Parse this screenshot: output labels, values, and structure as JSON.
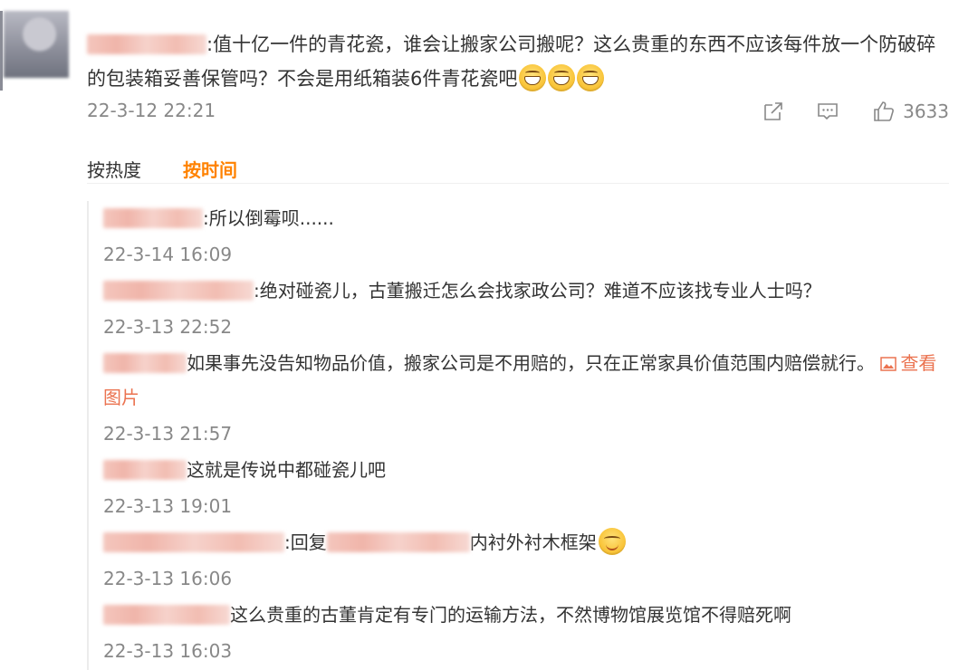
{
  "main_comment": {
    "text": ":值十亿一件的青花瓷，谁会让搬家公司搬呢？这么贵重的东西不应该每件放一个防破碎的包装箱妥善保管吗？不会是用纸箱装6件青花瓷吧",
    "emojis": [
      "grin",
      "grin",
      "grin"
    ],
    "time": "22-3-12 22:21",
    "actions": {
      "share_icon": "share-icon",
      "comment_icon": "comment-icon",
      "like_icon": "thumbs-up-icon",
      "like_count": "3633"
    }
  },
  "sort": {
    "hot_label": "按热度",
    "time_label": "按时间",
    "active_color": "#ff8200"
  },
  "replies": [
    {
      "text": ":所以倒霉呗......",
      "time": "22-3-14 16:09"
    },
    {
      "text": ":绝对碰瓷儿，古董搬迁怎么会找家政公司？难道不应该找专业人士吗？",
      "time": "22-3-13 22:52"
    },
    {
      "text": "如果事先没告知物品价值，搬家公司是不用赔的，只在正常家具价值范围内赔偿就行。",
      "link": "查看图片",
      "time": "22-3-13 21:57"
    },
    {
      "text": "这就是传说中都碰瓷儿吧",
      "time": "22-3-13 19:01"
    },
    {
      "text_before": ":回复",
      "text_after": "内衬外衬木框架",
      "time": "22-3-13 16:06"
    },
    {
      "text": "这么贵重的古董肯定有专门的运输方法，不然博物馆展览馆不得赔死啊",
      "time": "22-3-13 16:03"
    }
  ]
}
